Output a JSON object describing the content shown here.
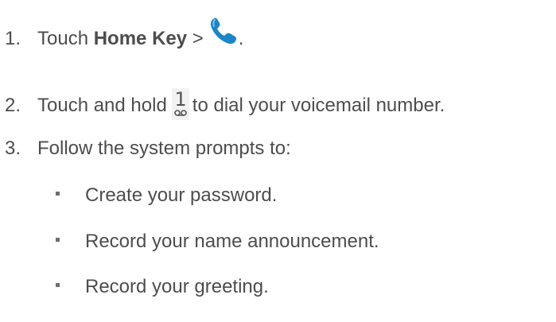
{
  "steps": [
    {
      "number": "1.",
      "text_before": "Touch ",
      "bold": "Home Key",
      "text_after": " >",
      "end": ".",
      "icon": "phone-icon",
      "icon_color": "#1a86c8"
    },
    {
      "number": "2.",
      "text_before": "Touch and hold",
      "key_digit": "1",
      "text_after": "to dial your voicemail number.",
      "icon": "voicemail-key-icon"
    },
    {
      "number": "3.",
      "text": "Follow the system prompts to:"
    }
  ],
  "bullets": [
    "Create your password.",
    "Record your name announcement.",
    "Record your greeting."
  ]
}
